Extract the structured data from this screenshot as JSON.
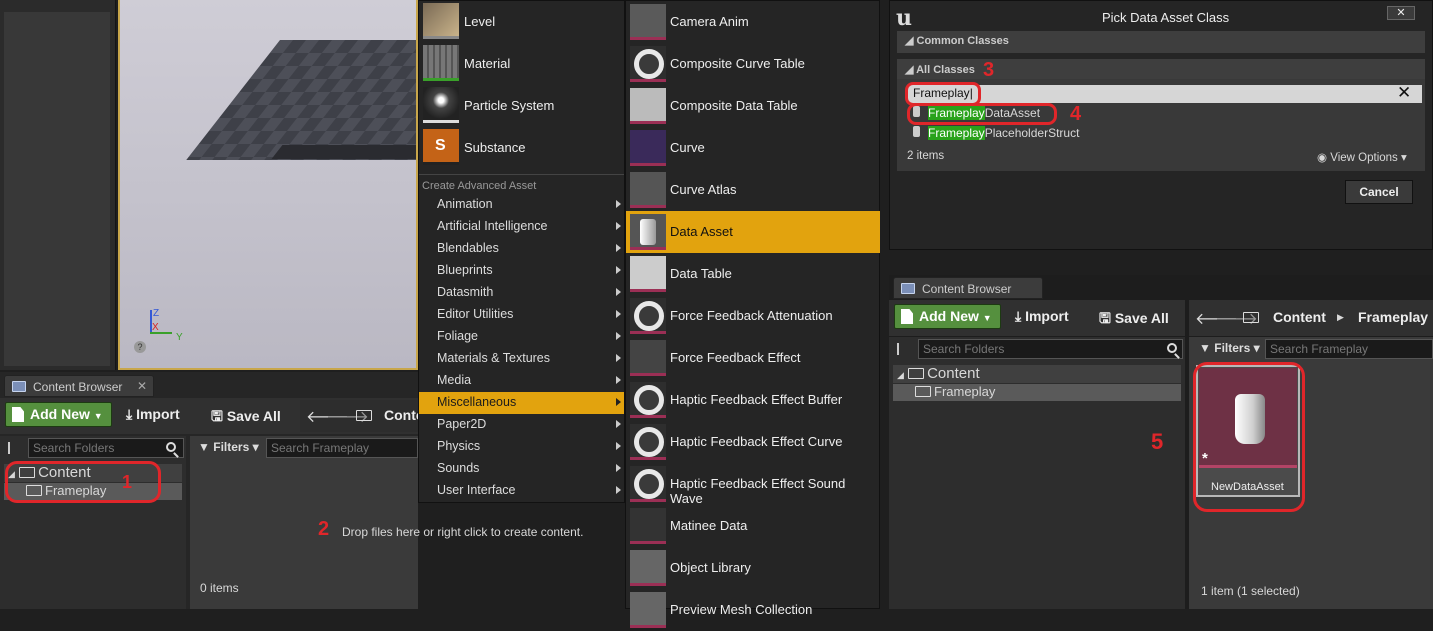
{
  "left_panel": {
    "tab": "Content Browser",
    "add_new": "Add New",
    "import": "Import",
    "save_all": "Save All",
    "search_folders_placeholder": "Search Folders",
    "filters": "Filters",
    "search_placeholder": "Search Frameplay",
    "breadcrumb_root": "Conte",
    "tree_root": "Content",
    "tree_child": "Frameplay",
    "empty_message": "Drop files here or right click to create content.",
    "items_count": "0 items"
  },
  "viewport": {
    "axis_z": "Z",
    "axis_x": "X",
    "axis_y": "Y"
  },
  "menu_basic": [
    {
      "label": "Level",
      "icon": "level-icon"
    },
    {
      "label": "Material",
      "icon": "material-icon"
    },
    {
      "label": "Particle System",
      "icon": "particle-icon"
    },
    {
      "label": "Substance",
      "icon": "substance-icon"
    }
  ],
  "menu_section": "Create Advanced Asset",
  "menu_advanced": [
    "Animation",
    "Artificial Intelligence",
    "Blendables",
    "Blueprints",
    "Datasmith",
    "Editor Utilities",
    "Foliage",
    "Materials & Textures",
    "Media",
    "Miscellaneous",
    "Paper2D",
    "Physics",
    "Sounds",
    "User Interface"
  ],
  "menu_advanced_selected": "Miscellaneous",
  "submenu": [
    "Camera Anim",
    "Composite Curve Table",
    "Composite Data Table",
    "Curve",
    "Curve Atlas",
    "Data Asset",
    "Data Table",
    "Force Feedback Attenuation",
    "Force Feedback Effect",
    "Haptic Feedback Effect Buffer",
    "Haptic Feedback Effect Curve",
    "Haptic Feedback Effect Sound Wave",
    "Matinee Data",
    "Object Library",
    "Preview Mesh Collection"
  ],
  "submenu_selected": "Data Asset",
  "dialog": {
    "title": "Pick Data Asset Class",
    "close": "X",
    "common_classes": "Common Classes",
    "all_classes": "All Classes",
    "search_value": "Frameplay",
    "results": [
      {
        "match": "Frameplay",
        "rest": "DataAsset"
      },
      {
        "match": "Frameplay",
        "rest": "PlaceholderStruct"
      }
    ],
    "items_count": "2 items",
    "view_options": "View Options",
    "cancel": "Cancel"
  },
  "right_panel": {
    "tab": "Content Browser",
    "add_new": "Add New",
    "import": "Import",
    "save_all": "Save All",
    "breadcrumb": [
      "Content",
      "Frameplay"
    ],
    "search_folders_placeholder": "Search Folders",
    "filters": "Filters",
    "search_placeholder": "Search Frameplay",
    "tree_root": "Content",
    "tree_child": "Frameplay",
    "asset_name": "NewDataAsset",
    "items_count": "1 item (1 selected)"
  },
  "annotations": [
    "1",
    "2",
    "3",
    "4",
    "5"
  ],
  "colors": {
    "accent": "#e2a30e",
    "green": "#55903e",
    "annotation": "#e0262a",
    "highlight": "#29a21a"
  }
}
